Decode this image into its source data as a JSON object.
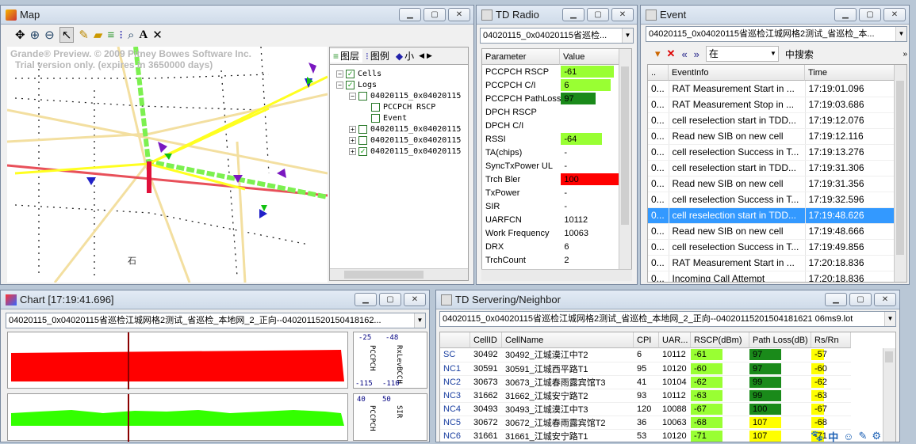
{
  "map": {
    "title": "Map",
    "watermark1": "Grande® Preview. © 2009 Pitney Bowes Software Inc.",
    "watermark2": "Trial version only. (expires in 3650000 days)",
    "street_char": "石",
    "layer_tabs": [
      "图层",
      "图例",
      "小"
    ],
    "tree": [
      {
        "label": "Cells",
        "indent": 0,
        "checked": true
      },
      {
        "label": "Logs",
        "indent": 0,
        "checked": true
      },
      {
        "label": "04020115_0x04020115",
        "indent": 1,
        "checked": false
      },
      {
        "label": "PCCPCH RSCP",
        "indent": 2,
        "checked": false
      },
      {
        "label": "Event",
        "indent": 2,
        "checked": false
      },
      {
        "label": "04020115_0x04020115",
        "indent": 1,
        "checked": false
      },
      {
        "label": "04020115_0x04020115",
        "indent": 1,
        "checked": false
      },
      {
        "label": "04020115_0x04020115",
        "indent": 1,
        "checked": true
      }
    ]
  },
  "radio": {
    "title": "TD Radio",
    "combo": "04020115_0x04020115省巡检...",
    "col_param": "Parameter",
    "col_value": "Value",
    "rows": [
      {
        "name": "PCCPCH RSCP",
        "value": "-61",
        "color": "#99ff33",
        "fill": 0.9
      },
      {
        "name": "PCCPCH C/I",
        "value": "6",
        "color": "#99ff33",
        "fill": 0.85
      },
      {
        "name": "PCCPCH PathLoss",
        "value": "97",
        "color": "#1a8a1a",
        "fill": 0.6
      },
      {
        "name": "DPCH RSCP",
        "value": "",
        "color": "",
        "fill": 0
      },
      {
        "name": "DPCH C/I",
        "value": "",
        "color": "",
        "fill": 0
      },
      {
        "name": "RSSI",
        "value": "-64",
        "color": "#99ff33",
        "fill": 0.7
      },
      {
        "name": "TA(chips)",
        "value": "-",
        "color": "",
        "fill": 0
      },
      {
        "name": "SyncTxPower UL",
        "value": "-",
        "color": "",
        "fill": 0
      },
      {
        "name": "Trch Bler",
        "value": "100",
        "color": "#ff0000",
        "fill": 1.0
      },
      {
        "name": "TxPower",
        "value": "-",
        "color": "",
        "fill": 0
      },
      {
        "name": "SIR",
        "value": "-",
        "color": "",
        "fill": 0
      },
      {
        "name": "UARFCN",
        "value": "10112",
        "color": "",
        "fill": 0
      },
      {
        "name": "Work Frequency",
        "value": "10063",
        "color": "",
        "fill": 0
      },
      {
        "name": "DRX",
        "value": "6",
        "color": "",
        "fill": 0
      },
      {
        "name": "TrchCount",
        "value": "2",
        "color": "",
        "fill": 0
      }
    ]
  },
  "event": {
    "title": "Event",
    "combo": "04020115_0x04020115省巡检江城网格2测试_省巡检_本...",
    "search_field": "在",
    "search_label": "中搜索",
    "col_dots": "..",
    "col_info": "EventInfo",
    "col_time": "Time",
    "rows": [
      {
        "id": "0...",
        "info": "RAT Measurement Start in ...",
        "time": "17:19:01.096",
        "selected": false
      },
      {
        "id": "0...",
        "info": "RAT Measurement Stop in ...",
        "time": "17:19:03.686",
        "selected": false
      },
      {
        "id": "0...",
        "info": "cell reselection start in TDD...",
        "time": "17:19:12.076",
        "selected": false
      },
      {
        "id": "0...",
        "info": "Read new SIB on new cell",
        "time": "17:19:12.116",
        "selected": false
      },
      {
        "id": "0...",
        "info": "cell reselection Success in T...",
        "time": "17:19:13.276",
        "selected": false
      },
      {
        "id": "0...",
        "info": "cell reselection start in TDD...",
        "time": "17:19:31.306",
        "selected": false
      },
      {
        "id": "0...",
        "info": "Read new SIB on new cell",
        "time": "17:19:31.356",
        "selected": false
      },
      {
        "id": "0...",
        "info": "cell reselection Success in T...",
        "time": "17:19:32.596",
        "selected": false
      },
      {
        "id": "0...",
        "info": "cell reselection start in TDD...",
        "time": "17:19:48.626",
        "selected": true
      },
      {
        "id": "0...",
        "info": "Read new SIB on new cell",
        "time": "17:19:48.666",
        "selected": false
      },
      {
        "id": "0...",
        "info": "cell reselection Success in T...",
        "time": "17:19:49.856",
        "selected": false
      },
      {
        "id": "0...",
        "info": "RAT Measurement Start in ...",
        "time": "17:20:18.836",
        "selected": false
      },
      {
        "id": "0...",
        "info": "Incoming Call Attempt",
        "time": "17:20:18.836",
        "selected": false
      }
    ]
  },
  "chart": {
    "title": "Chart [17:19:41.696]",
    "combo": "04020115_0x04020115省巡检江城网格2测试_省巡检_本地网_2_正向--0402011520150418162...",
    "top": {
      "max_left": "-25",
      "max_right": "-48",
      "min_left": "-115",
      "min_right": "-110",
      "label_left": "PCCPCH",
      "label_right": "RxLevBCCH",
      "color": "#ff0000"
    },
    "bottom": {
      "max_left": "40",
      "max_right": "50",
      "label_left": "PCCPCH",
      "label_right": "SIR",
      "color": "#33ff00"
    }
  },
  "serving": {
    "title": "TD Servering/Neighbor",
    "combo": "04020115_0x04020115省巡检江城网格2测试_省巡检_本地网_2_正向--04020115201504181621 06ms9.lot",
    "headers": [
      "",
      "CellID",
      "CellName",
      "CPI",
      "UAR...",
      "RSCP(dBm)",
      "Path Loss(dB)",
      "Rs/Rn"
    ],
    "rows": [
      {
        "type": "SC",
        "cellid": "30492",
        "name": "30492_江城漠江中T2",
        "cpi": "6",
        "uarfcn": "10112",
        "rscp": "-61",
        "rscp_color": "#99ff33",
        "pl": "97",
        "pl_color": "#1a8a1a",
        "rs": "-57",
        "rs_color": "#ffff00"
      },
      {
        "type": "NC1",
        "cellid": "30591",
        "name": "30591_江城西平路T1",
        "cpi": "95",
        "uarfcn": "10120",
        "rscp": "-60",
        "rscp_color": "#99ff33",
        "pl": "97",
        "pl_color": "#1a8a1a",
        "rs": "-60",
        "rs_color": "#ffff00"
      },
      {
        "type": "NC2",
        "cellid": "30673",
        "name": "30673_江城春雨露宾馆T3",
        "cpi": "41",
        "uarfcn": "10104",
        "rscp": "-62",
        "rscp_color": "#99ff33",
        "pl": "99",
        "pl_color": "#1a8a1a",
        "rs": "-62",
        "rs_color": "#ffff00"
      },
      {
        "type": "NC3",
        "cellid": "31662",
        "name": "31662_江城安宁路T2",
        "cpi": "93",
        "uarfcn": "10112",
        "rscp": "-63",
        "rscp_color": "#99ff33",
        "pl": "99",
        "pl_color": "#1a8a1a",
        "rs": "-63",
        "rs_color": "#ffff00"
      },
      {
        "type": "NC4",
        "cellid": "30493",
        "name": "30493_江城漠江中T3",
        "cpi": "120",
        "uarfcn": "10088",
        "rscp": "-67",
        "rscp_color": "#99ff33",
        "pl": "100",
        "pl_color": "#1a8a1a",
        "rs": "-67",
        "rs_color": "#ffff00"
      },
      {
        "type": "NC5",
        "cellid": "30672",
        "name": "30672_江城春雨露宾馆T2",
        "cpi": "36",
        "uarfcn": "10063",
        "rscp": "-68",
        "rscp_color": "#99ff33",
        "pl": "107",
        "pl_color": "#ffff00",
        "rs": "-68",
        "rs_color": "#ffff00"
      },
      {
        "type": "NC6",
        "cellid": "31661",
        "name": "31661_江城安宁路T1",
        "cpi": "53",
        "uarfcn": "10120",
        "rscp": "-71",
        "rscp_color": "#99ff33",
        "pl": "107",
        "pl_color": "#ffff00",
        "rs": "-71",
        "rs_color": "#ffff00"
      }
    ]
  },
  "tray": {
    "lang": "中"
  }
}
